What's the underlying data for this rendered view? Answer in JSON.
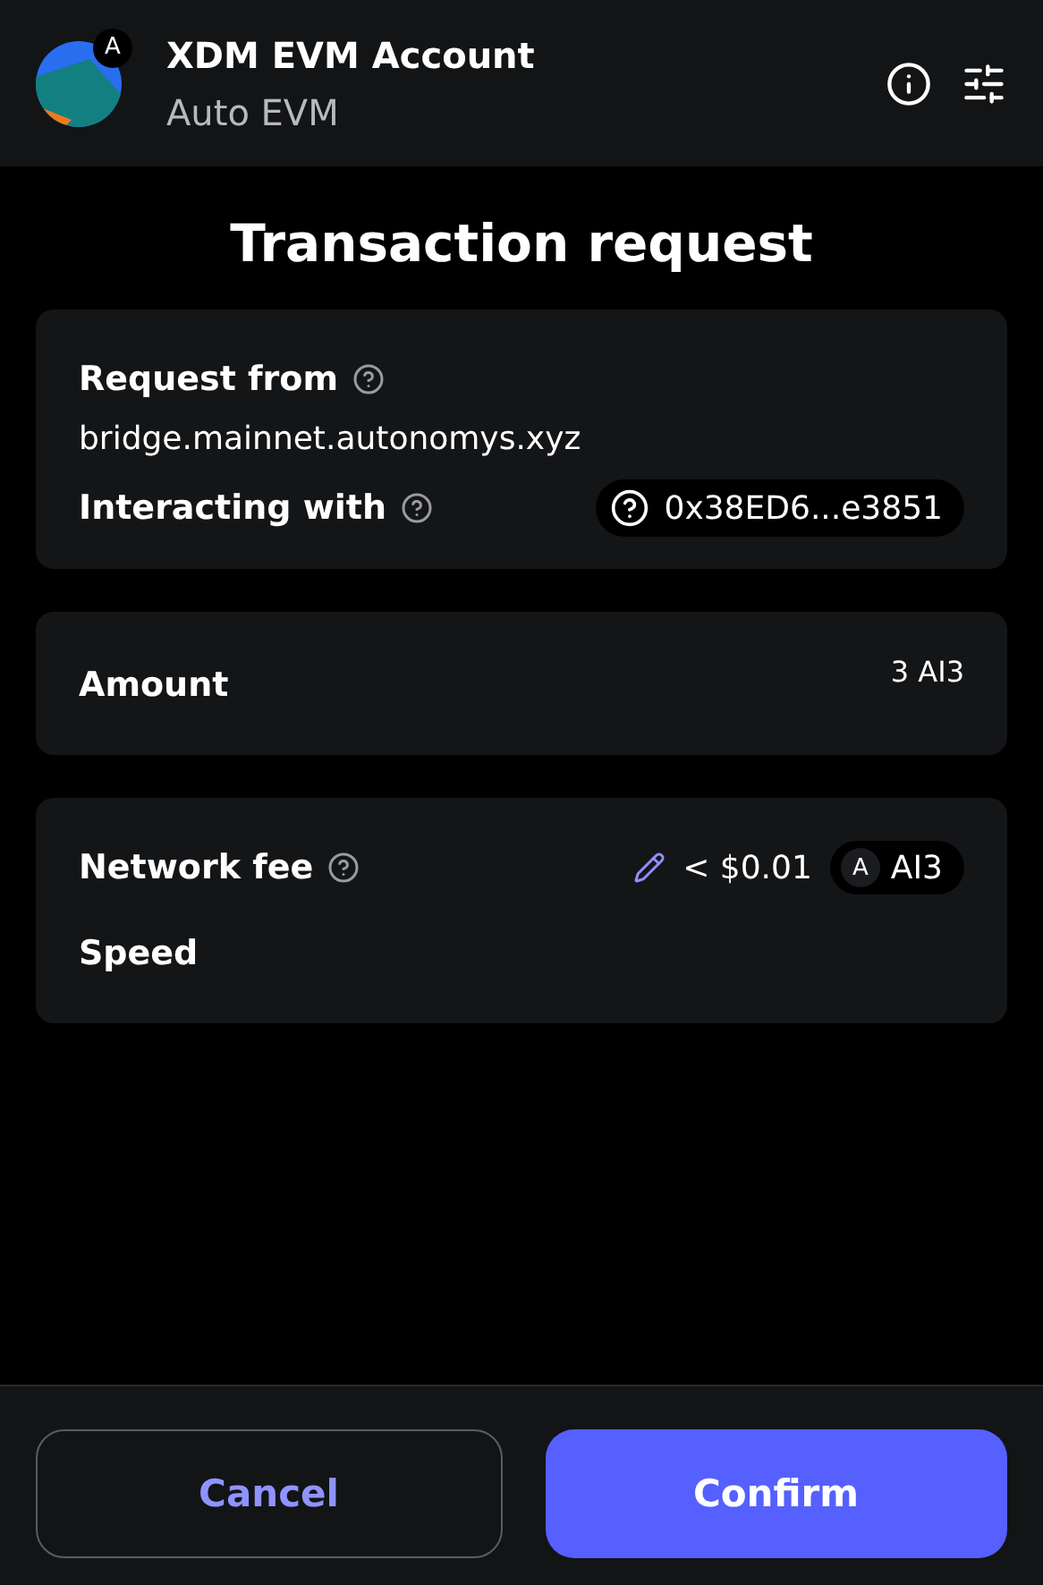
{
  "header": {
    "avatar_badge": "A",
    "account_name": "XDM EVM Account",
    "network": "Auto EVM"
  },
  "title": "Transaction request",
  "request_card": {
    "request_from_label": "Request from",
    "origin": "bridge.mainnet.autonomys.xyz",
    "interacting_label": "Interacting with",
    "contract": "0x38ED6...e3851"
  },
  "amount_card": {
    "label": "Amount",
    "value": "3 AI3"
  },
  "fee_card": {
    "fee_label": "Network fee",
    "fee_value": "< $0.01",
    "token_icon": "A",
    "token": "AI3",
    "speed_label": "Speed"
  },
  "buttons": [
    {
      "label": "Cancel",
      "kind": "secondary"
    },
    {
      "label": "Confirm",
      "kind": "primary"
    }
  ]
}
